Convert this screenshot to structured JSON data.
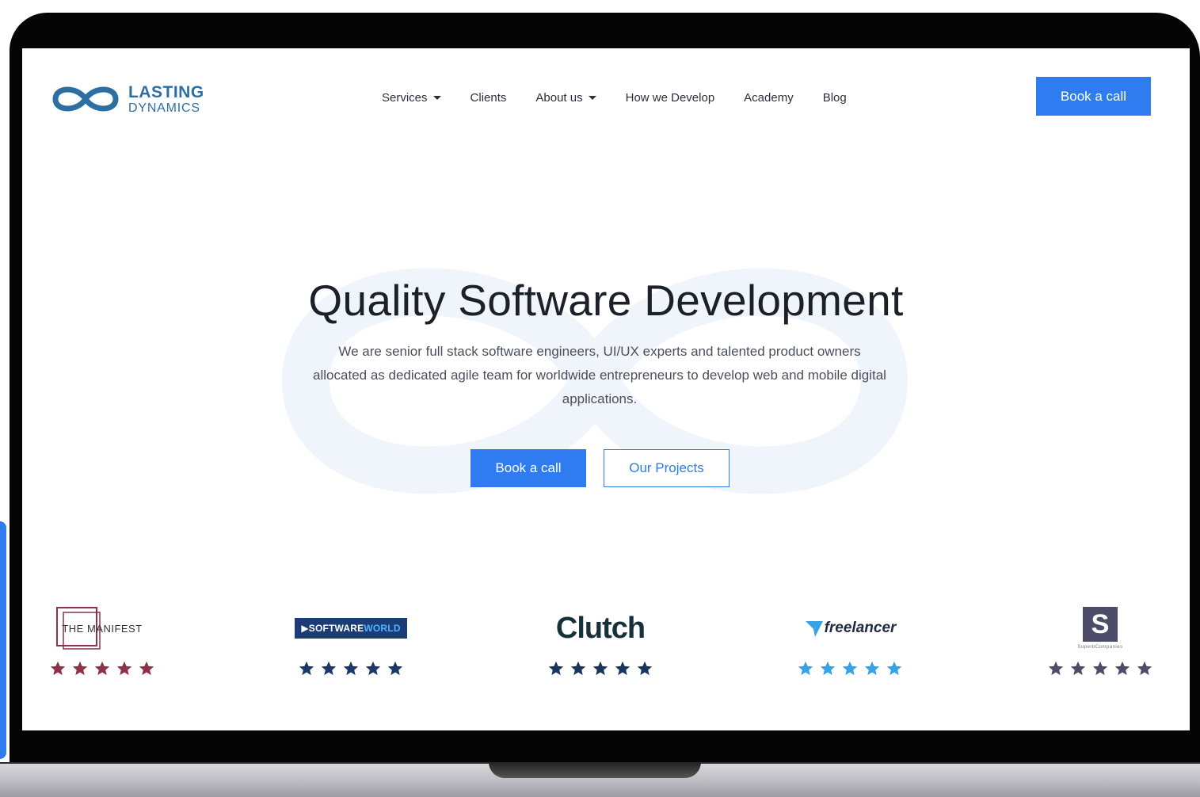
{
  "brand": {
    "line1": "LASTING",
    "line2": "DYNAMICS"
  },
  "nav": {
    "items": [
      {
        "label": "Services",
        "dropdown": true
      },
      {
        "label": "Clients",
        "dropdown": false
      },
      {
        "label": "About us",
        "dropdown": true
      },
      {
        "label": "How we Develop",
        "dropdown": false
      },
      {
        "label": "Academy",
        "dropdown": false
      },
      {
        "label": "Blog",
        "dropdown": false
      }
    ],
    "cta_label": "Book a call"
  },
  "hero": {
    "title": "Quality Software Development",
    "subtitle": "We are senior full stack software engineers, UI/UX experts and talented product owners allocated as dedicated agile team for worldwide entrepreneurs to develop web and mobile digital applications.",
    "primary_button": "Book a call",
    "secondary_button": "Our Projects"
  },
  "reviews": [
    {
      "platform": "THE MANIFEST",
      "rating": 5,
      "star_color": "#8c3349"
    },
    {
      "platform_part1": "SOFTWARE",
      "platform_part2": "WORLD",
      "rating": 5,
      "star_color": "#1c3868"
    },
    {
      "platform": "Clutch",
      "rating": 5,
      "star_color": "#17375f"
    },
    {
      "platform": "freelancer",
      "rating": 5,
      "star_color": "#36a3e6"
    },
    {
      "platform": "S",
      "caption": "SuperbCompanies",
      "rating": 5,
      "star_color": "#4d4d6a"
    }
  ],
  "colors": {
    "accent": "#2f7bf0",
    "brand": "#2d6fa3",
    "text_dark": "#1c2029",
    "text_body": "#4a4f5c"
  }
}
